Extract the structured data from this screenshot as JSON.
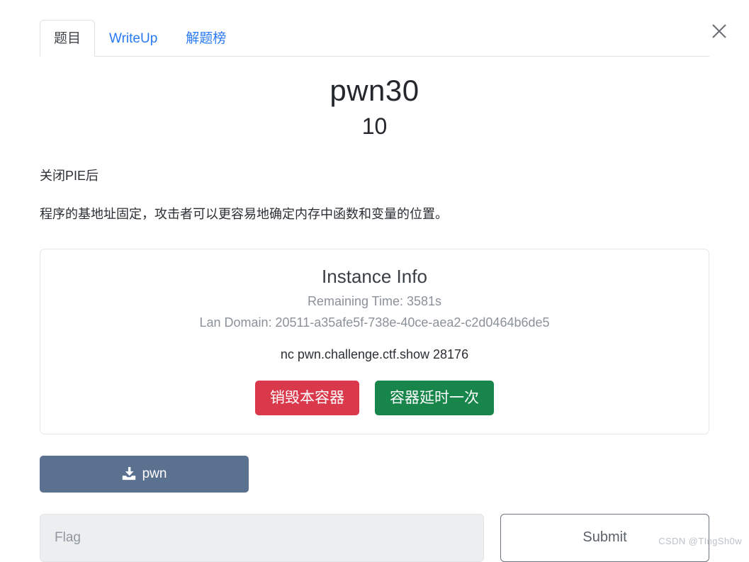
{
  "window": {
    "close_label": "✕"
  },
  "tabs": [
    {
      "label": "题目",
      "active": true
    },
    {
      "label": "WriteUp",
      "active": false
    },
    {
      "label": "解题榜",
      "active": false
    }
  ],
  "challenge": {
    "title": "pwn30",
    "score": "10",
    "description_line1": "关闭PIE后",
    "description_line2": "程序的基地址固定，攻击者可以更容易地确定内存中函数和变量的位置。"
  },
  "instance": {
    "heading": "Instance Info",
    "remaining_time": "Remaining Time: 3581s",
    "lan_domain": "Lan Domain: 20511-a35afe5f-738e-40ce-aea2-c2d0464b6de5",
    "connection": "nc pwn.challenge.ctf.show 28176",
    "destroy_label": "销毁本容器",
    "extend_label": "容器延时一次"
  },
  "attachment": {
    "label": "pwn",
    "icon": "download-icon"
  },
  "flag": {
    "value": "",
    "placeholder": "Flag",
    "submit_label": "Submit"
  },
  "watermark": "CSDN @TIngSh0w",
  "colors": {
    "tab_active_text": "#3f4448",
    "tab_link": "#2979f2",
    "destroy_bg": "#d9394b",
    "extend_bg": "#18864b",
    "download_bg": "#5b7190",
    "muted_text": "#8b9199"
  }
}
